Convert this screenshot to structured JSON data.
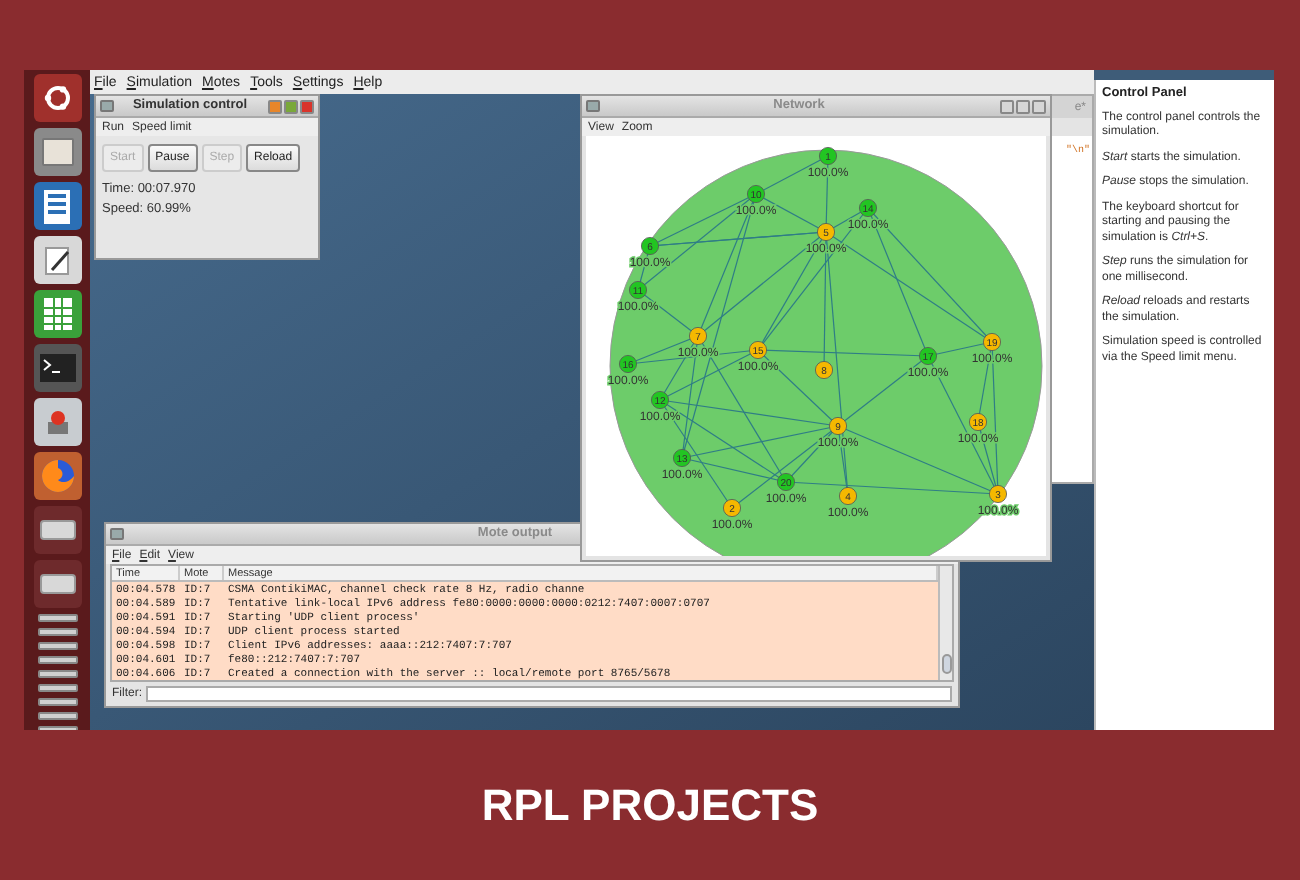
{
  "menu_bar": [
    "File",
    "Simulation",
    "Motes",
    "Tools",
    "Settings",
    "Help"
  ],
  "simulation_control": {
    "title": "Simulation control",
    "menu": [
      "Run",
      "Speed limit"
    ],
    "buttons": [
      {
        "label": "Start",
        "disabled": true
      },
      {
        "label": "Pause",
        "disabled": false
      },
      {
        "label": "Step",
        "disabled": true
      },
      {
        "label": "Reload",
        "disabled": false
      }
    ],
    "time": "Time: 00:07.970",
    "speed": "Speed: 60.99%"
  },
  "hidden_window": {
    "title": "e*",
    "text": "\"\\n\""
  },
  "network": {
    "title": "Network",
    "menu": [
      "View",
      "Zoom"
    ],
    "nodes": [
      {
        "id": "1",
        "color": "#22c522",
        "reading": "100.0%"
      },
      {
        "id": "10",
        "color": "#22c522",
        "reading": "100.0%"
      },
      {
        "id": "14",
        "color": "#22c522",
        "reading": "100.0%"
      },
      {
        "id": "5",
        "color": "#f5b800",
        "reading": "100.0%"
      },
      {
        "id": "6",
        "color": "#22c522",
        "reading": "100.0%"
      },
      {
        "id": "11",
        "color": "#22c522",
        "reading": "100.0%"
      },
      {
        "id": "7",
        "color": "#f5b800",
        "reading": "100.0%"
      },
      {
        "id": "15",
        "color": "#f5b800",
        "reading": "100.0%"
      },
      {
        "id": "16",
        "color": "#22c522",
        "reading": "100.0%"
      },
      {
        "id": "8",
        "color": "#f5b800"
      },
      {
        "id": "17",
        "color": "#22c522",
        "reading": "100.0%"
      },
      {
        "id": "19",
        "color": "#f5b800",
        "reading": "100.0%"
      },
      {
        "id": "12",
        "color": "#22c522",
        "reading": "100.0%"
      },
      {
        "id": "9",
        "color": "#f5b800",
        "reading": "100.0%"
      },
      {
        "id": "18",
        "color": "#f5b800",
        "reading": "100.0%"
      },
      {
        "id": "13",
        "color": "#22c522",
        "reading": "100.0%"
      },
      {
        "id": "20",
        "color": "#22c522",
        "reading": "100.0%"
      },
      {
        "id": "4",
        "color": "#f5b800",
        "reading": "100.0%"
      },
      {
        "id": "2",
        "color": "#f5b800",
        "reading": "100.0%"
      },
      {
        "id": "3",
        "color": "#f5b800",
        "reading": "100.0%"
      }
    ]
  },
  "mote_output": {
    "title": "Mote output",
    "menu": [
      "File",
      "Edit",
      "View"
    ],
    "columns": [
      "Time",
      "Mote",
      "Message"
    ],
    "rows": [
      [
        "00:04.578",
        "ID:7",
        "CSMA ContikiMAC, channel check rate 8 Hz, radio channe"
      ],
      [
        "00:04.589",
        "ID:7",
        "Tentative link-local IPv6 address fe80:0000:0000:0000:0212:7407:0007:0707"
      ],
      [
        "00:04.591",
        "ID:7",
        "Starting 'UDP client process'"
      ],
      [
        "00:04.594",
        "ID:7",
        "UDP client process started"
      ],
      [
        "00:04.598",
        "ID:7",
        "Client IPv6 addresses: aaaa::212:7407:7:707"
      ],
      [
        "00:04.601",
        "ID:7",
        "fe80::212:7407:7:707"
      ],
      [
        "00:04.606",
        "ID:7",
        "Created a connection with the server :: local/remote port 8765/5678"
      ]
    ],
    "filter_label": "Filter:"
  },
  "control_panel": {
    "title": "Control Panel",
    "paragraphs": [
      "The control panel controls the simulation.",
      "*Start* starts the simulation.",
      "*Pause* stops the simulation.",
      "The keyboard shortcut for starting and pausing the simulation is *Ctrl+S*.",
      "*Step* runs the simulation for one millisecond.",
      "*Reload* reloads and restarts the simulation.",
      "Simulation speed is controlled via the Speed limit menu."
    ]
  },
  "banner_title": "RPL PROJECTS"
}
